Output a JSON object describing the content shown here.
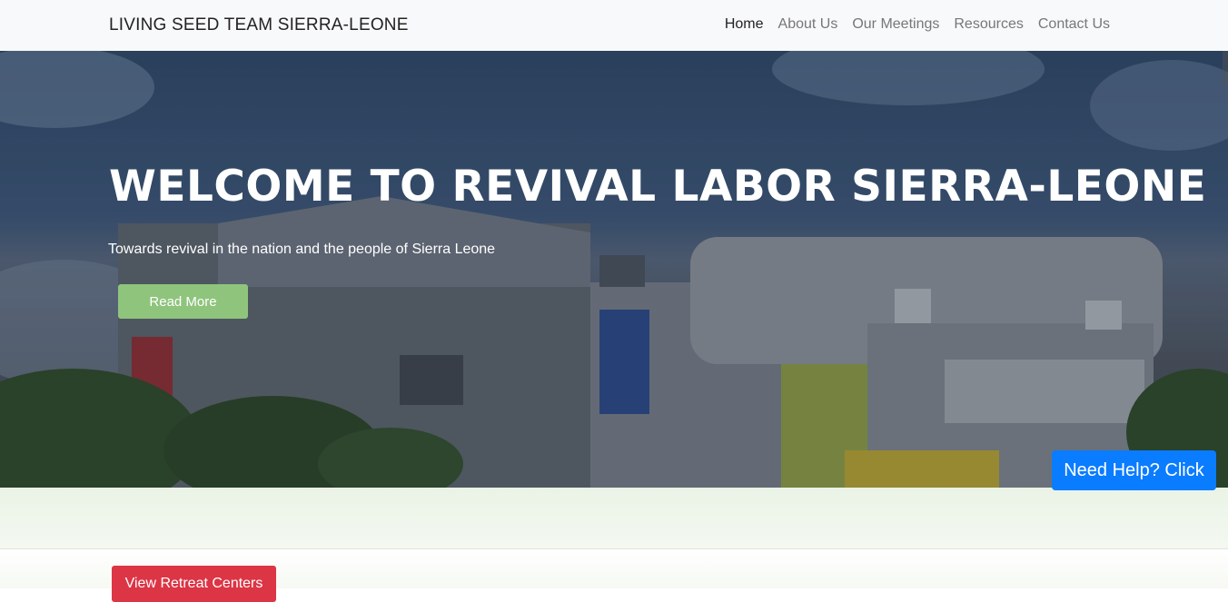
{
  "navbar": {
    "brand": "LIVING SEED TEAM SIERRA-LEONE",
    "links": [
      {
        "label": "Home",
        "active": true
      },
      {
        "label": "About Us",
        "active": false
      },
      {
        "label": "Our Meetings",
        "active": false
      },
      {
        "label": "Resources",
        "active": false
      },
      {
        "label": "Contact Us",
        "active": false
      }
    ]
  },
  "hero": {
    "title": "WELCOME TO REVIVAL LABOR SIERRA-LEONE",
    "subtitle": "Towards revival in the nation and the people of Sierra Leone",
    "cta_label": "Read More",
    "cta_color": "#8fc47d"
  },
  "lower": {
    "retreat_button_label": "View Retreat Centers",
    "retreat_button_color": "#dc3545"
  },
  "help_widget": {
    "label": "Need Help? Click",
    "color": "#0a7cff"
  }
}
